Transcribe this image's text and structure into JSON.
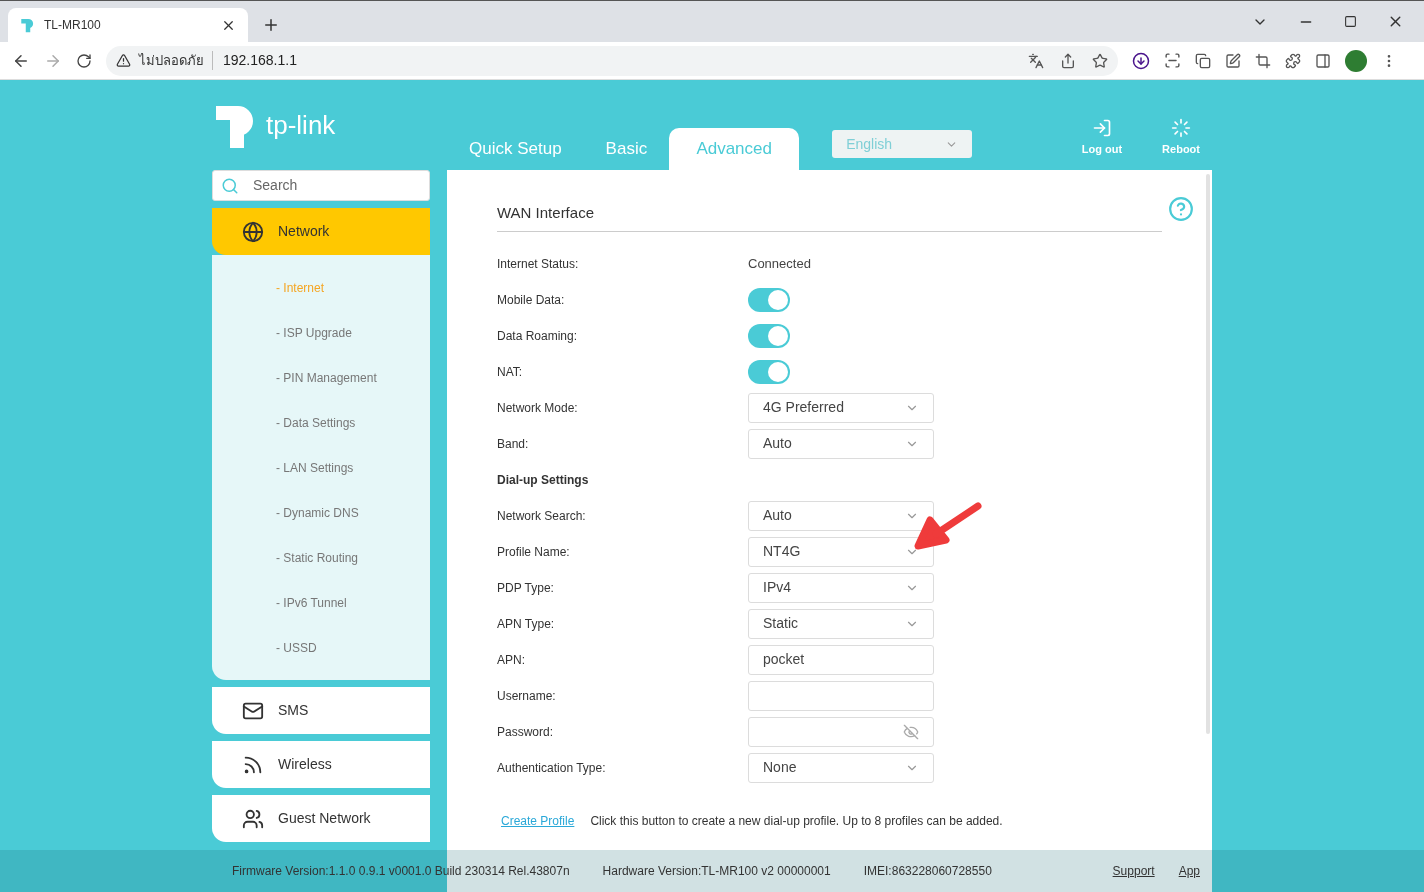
{
  "browser": {
    "tab_title": "TL-MR100",
    "security_label": "ไม่ปลอดภัย",
    "url": "192.168.1.1"
  },
  "header": {
    "brand": "tp-link",
    "nav_tabs": [
      {
        "label": "Quick Setup",
        "selected": false
      },
      {
        "label": "Basic",
        "selected": false
      },
      {
        "label": "Advanced",
        "selected": true
      }
    ],
    "language": "English",
    "actions": [
      {
        "kind": "logout",
        "label": "Log out"
      },
      {
        "kind": "reboot",
        "label": "Reboot"
      }
    ]
  },
  "sidebar": {
    "search_placeholder": "Search",
    "menu": [
      {
        "kind": "network",
        "label": "Network",
        "selected": true,
        "children": [
          {
            "label": "- Internet",
            "selected": true
          },
          {
            "label": "- ISP Upgrade",
            "selected": false
          },
          {
            "label": "- PIN Management",
            "selected": false
          },
          {
            "label": "- Data Settings",
            "selected": false
          },
          {
            "label": "- LAN Settings",
            "selected": false
          },
          {
            "label": "- Dynamic DNS",
            "selected": false
          },
          {
            "label": "- Static Routing",
            "selected": false
          },
          {
            "label": "- IPv6 Tunnel",
            "selected": false
          },
          {
            "label": "- USSD",
            "selected": false
          }
        ]
      },
      {
        "kind": "sms",
        "label": "SMS",
        "selected": false
      },
      {
        "kind": "wireless",
        "label": "Wireless",
        "selected": false
      },
      {
        "kind": "guest",
        "label": "Guest Network",
        "selected": false
      }
    ]
  },
  "panel": {
    "title": "WAN Interface",
    "fields": [
      {
        "kind": "text",
        "label": "Internet Status:",
        "value": "Connected"
      },
      {
        "kind": "toggle",
        "label": "Mobile Data:",
        "on": true
      },
      {
        "kind": "toggle",
        "label": "Data Roaming:",
        "on": true
      },
      {
        "kind": "toggle",
        "label": "NAT:",
        "on": true
      },
      {
        "kind": "select",
        "label": "Network Mode:",
        "value": "4G Preferred"
      },
      {
        "kind": "select",
        "label": "Band:",
        "value": "Auto"
      },
      {
        "kind": "heading",
        "label": "Dial-up Settings"
      },
      {
        "kind": "select",
        "label": "Network Search:",
        "value": "Auto"
      },
      {
        "kind": "select",
        "label": "Profile Name:",
        "value": "NT4G"
      },
      {
        "kind": "select",
        "label": "PDP Type:",
        "value": "IPv4"
      },
      {
        "kind": "select",
        "label": "APN Type:",
        "value": "Static"
      },
      {
        "kind": "input",
        "label": "APN:",
        "value": "pocket"
      },
      {
        "kind": "input",
        "label": "Username:"
      },
      {
        "kind": "password",
        "label": "Password:"
      },
      {
        "kind": "select",
        "label": "Authentication Type:",
        "value": "None"
      }
    ],
    "create_link": "Create Profile",
    "create_note": "Click this button to create a new dial-up profile. Up to 8 profiles can be added."
  },
  "footer": {
    "info": [
      "Firmware Version:1.1.0 0.9.1 v0001.0 Build 230314 Rel.43807n",
      "Hardware Version:TL-MR100 v2 00000001",
      "IMEI:863228060728550"
    ],
    "links": [
      "Support",
      "App"
    ]
  }
}
